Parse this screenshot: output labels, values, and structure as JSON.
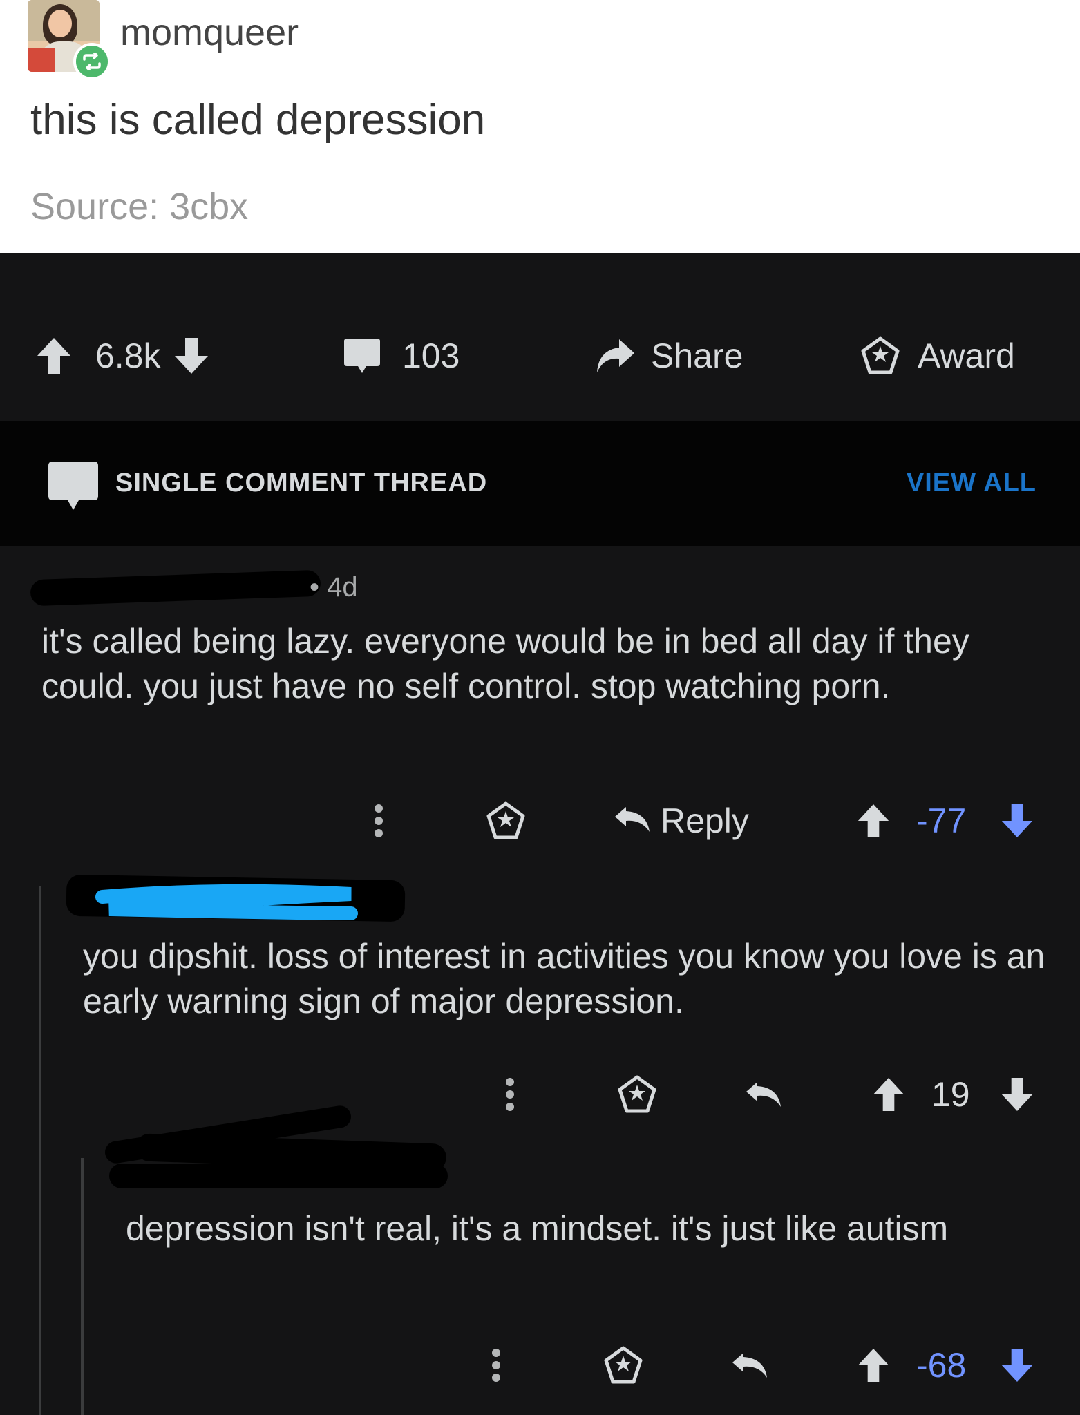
{
  "tumblr": {
    "username": "momqueer",
    "text": "this is called depression",
    "source": "Source: 3cbx"
  },
  "post_actions": {
    "score": "6.8k",
    "comments": "103",
    "share": "Share",
    "award": "Award"
  },
  "thread": {
    "label": "SINGLE COMMENT THREAD",
    "view_all": "VIEW ALL"
  },
  "comments": [
    {
      "time": "4d",
      "text": "it's called being lazy. everyone would be in bed all day if they could. you just have no self control. stop watching porn.",
      "reply_label": "Reply",
      "score": "-77"
    },
    {
      "text": "you dipshit. loss of interest in activities you know you love is an early warning sign of major depression.",
      "score": "19"
    },
    {
      "text": "depression isn't real, it's a mindset. it's just like autism",
      "score": "-68"
    }
  ],
  "colors": {
    "background": "#141415",
    "thread_bar": "#040404",
    "link_blue": "#1a74c9",
    "downvoted": "#7193ff",
    "scribble_blue": "#19a7f5"
  },
  "icons": [
    "upvote-arrow-icon",
    "downvote-arrow-icon",
    "comment-bubble-icon",
    "share-arrow-icon",
    "award-icon",
    "more-dots-icon",
    "reply-arrow-icon",
    "reblog-icon"
  ]
}
